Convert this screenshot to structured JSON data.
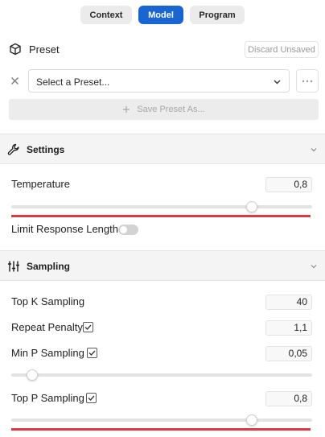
{
  "tabs": [
    {
      "label": "Context",
      "active": false
    },
    {
      "label": "Model",
      "active": true
    },
    {
      "label": "Program",
      "active": false
    }
  ],
  "colors": {
    "accent": "#1966d2",
    "warning_line": "#dc3945"
  },
  "preset": {
    "title": "Preset",
    "discard_label": "Discard Unsaved",
    "select_placeholder": "Select a Preset...",
    "more_label": "···",
    "save_label": "Save Preset As..."
  },
  "settings": {
    "title": "Settings",
    "temperature": {
      "label": "Temperature",
      "value": "0,8",
      "slider_fraction": 0.8
    },
    "limit_response_length": {
      "label": "Limit Response Length",
      "enabled": false
    }
  },
  "sampling": {
    "title": "Sampling",
    "top_k": {
      "label": "Top K Sampling",
      "value": "40"
    },
    "repeat_penalty": {
      "label": "Repeat Penalty",
      "checked": true,
      "value": "1,1"
    },
    "min_p": {
      "label": "Min P Sampling",
      "checked": true,
      "value": "0,05",
      "slider_fraction": 0.07
    },
    "top_p": {
      "label": "Top P Sampling",
      "checked": true,
      "value": "0,8",
      "slider_fraction": 0.8
    }
  },
  "icons": {
    "preset": "cube-icon",
    "clear": "close-icon",
    "settings": "wrench-icon",
    "sampling": "sliders-icon",
    "collapse": "chevron-down-icon"
  }
}
